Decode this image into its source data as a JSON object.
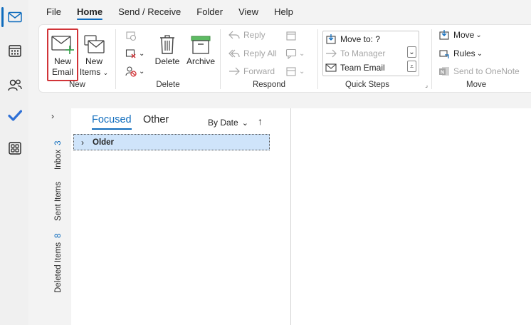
{
  "menu": {
    "tabs": [
      "File",
      "Home",
      "Send / Receive",
      "Folder",
      "View",
      "Help"
    ],
    "active_tab": "Home"
  },
  "rail": {
    "icons": [
      "mail-icon",
      "calendar-icon",
      "people-icon",
      "todo-icon",
      "apps-icon"
    ],
    "accent": "#0f6cbd"
  },
  "ribbon": {
    "new": {
      "label": "New",
      "new_email_line1": "New",
      "new_email_line2": "Email",
      "new_items_line1": "New",
      "new_items_line2": "Items"
    },
    "delete": {
      "label": "Delete",
      "delete": "Delete",
      "archive": "Archive"
    },
    "respond": {
      "label": "Respond",
      "reply": "Reply",
      "reply_all": "Reply All",
      "forward": "Forward"
    },
    "quick_steps": {
      "label": "Quick Steps",
      "items": [
        "Move to: ?",
        "To Manager",
        "Team Email"
      ]
    },
    "move": {
      "label": "Move",
      "move": "Move",
      "rules": "Rules",
      "onenote": "Send to OneNote"
    }
  },
  "folders": {
    "inbox": {
      "label": "Inbox",
      "count": "3"
    },
    "sent": {
      "label": "Sent Items"
    },
    "deleted": {
      "label": "Deleted Items",
      "count": "8"
    }
  },
  "list": {
    "tab_focused": "Focused",
    "tab_other": "Other",
    "sort": "By Date",
    "group": "Older"
  },
  "colors": {
    "highlight_border": "#d13438",
    "selection_bg": "#cfe4fa",
    "brand_blue": "#0f6cbd"
  }
}
